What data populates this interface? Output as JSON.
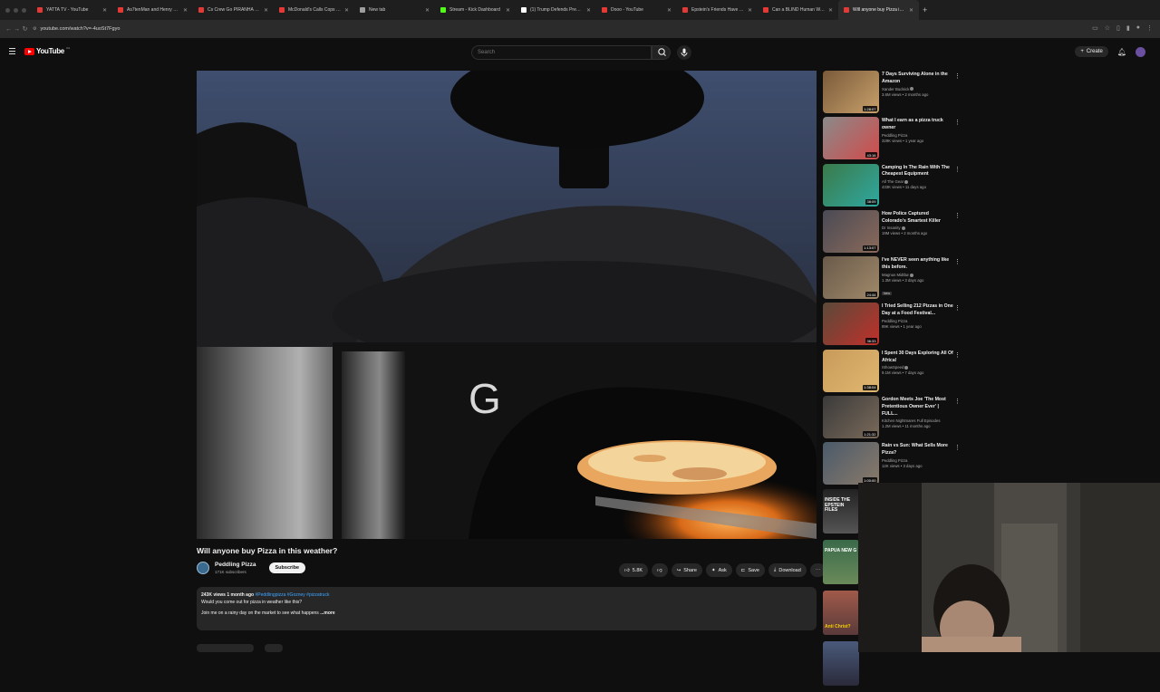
{
  "browser": {
    "tabs": [
      {
        "title": "YATTA TV - YouTube",
        "favicon": "#e53935"
      },
      {
        "title": "As7tenMan and Henry Get In...",
        "favicon": "#e53935"
      },
      {
        "title": "Cs Crew Go PIRANHA FISHI...",
        "favicon": "#e53935"
      },
      {
        "title": "McDonald's Calls Cops on Fi...",
        "favicon": "#e53935"
      },
      {
        "title": "New tab",
        "favicon": "#9e9e9e"
      },
      {
        "title": "Stream - Kick Dashboard",
        "favicon": "#53fc18"
      },
      {
        "title": "(1) Trump Defends Preemptiv...",
        "favicon": "#ffffff"
      },
      {
        "title": "Dooo - YouTube",
        "favicon": "#e53935"
      },
      {
        "title": "Epstein's Friends Have Been...",
        "favicon": "#e53935"
      },
      {
        "title": "Can a BLIND Human Walk Str...",
        "favicon": "#e53935"
      },
      {
        "title": "Will anyone buy Pizza in th...",
        "favicon": "#e53935",
        "active": true
      }
    ],
    "url": "youtube.com/watch?v=-4uoSt7Fgyo"
  },
  "youtube": {
    "logo_text": "YouTube",
    "logo_country": "CA",
    "search_placeholder": "Search",
    "create_label": "Create"
  },
  "video": {
    "title": "Will anyone buy Pizza in this weather?",
    "channel_name": "Peddling Pizza",
    "subscribers": "171K subscribers",
    "subscribe_label": "Subscribe",
    "likes": "5.8K",
    "share_label": "Share",
    "ask_label": "Ask",
    "save_label": "Save",
    "download_label": "Download",
    "oven_brand_letter": "G",
    "description": {
      "meta": "243K views  1 month ago",
      "tags": "#Peddlingpizza #Gozney #pizzatruck",
      "line1": "Would you come out for pizza in weather like this?",
      "line2": "Join me on a rainy day on the market to see what happens",
      "more": "...more"
    }
  },
  "recommendations": [
    {
      "title": "7 Days Surviving Alone in the Amazon",
      "channel": "Xander Budnick",
      "verified": true,
      "views": "3.6M views • 2 months ago",
      "duration": "1:28:07",
      "thumb": [
        "#7a5a3a",
        "#c8a06a"
      ]
    },
    {
      "title": "What I earn as a pizza truck owner",
      "channel": "Peddling Pizza",
      "verified": false,
      "views": "329K views • 1 year ago",
      "duration": "43:16",
      "thumb": [
        "#8a8a8a",
        "#d24a4a"
      ]
    },
    {
      "title": "Camping In The Rain With The Cheapest Equipment",
      "channel": "All The Gear",
      "verified": true,
      "views": "433K views • 11 days ago",
      "duration": "38:09",
      "thumb": [
        "#3b7a4a",
        "#2fa8a0"
      ]
    },
    {
      "title": "How Police Captured Colorado's Smartest Killer",
      "channel": "Dr Insanity",
      "verified": true,
      "views": "19M views • 2 months ago",
      "duration": "1:13:07",
      "thumb": [
        "#4a4a55",
        "#8a6a5a"
      ]
    },
    {
      "title": "I've NEVER seen anything like this before.",
      "channel": "Magnus Midtbø",
      "verified": true,
      "views": "1.3M views • 3 days ago",
      "duration": "24:44",
      "new": "New",
      "thumb": [
        "#6a5a4a",
        "#a0896a"
      ]
    },
    {
      "title": "I Tried Selling 212 Pizzas in One Day at a Food Festival...",
      "channel": "Peddling Pizza",
      "verified": false,
      "views": "89K views • 1 year ago",
      "duration": "36:33",
      "thumb": [
        "#5a4a3a",
        "#c0302a"
      ]
    },
    {
      "title": "I Spent 30 Days Exploring All Of Africa!",
      "channel": "IShowSpeed",
      "verified": true,
      "views": "9.1M views • 7 days ago",
      "duration": "1:38:04",
      "thumb": [
        "#c89a5a",
        "#e0b870"
      ]
    },
    {
      "title": "Gordon Meets Joe 'The Most Pretentious Owner Ever' | FULL...",
      "channel": "Kitchen Nightmares Full Episodes",
      "verified": false,
      "views": "1.2M views • 11 months ago",
      "duration": "1:21:32",
      "thumb": [
        "#3a3a3a",
        "#7a6a5a"
      ]
    },
    {
      "title": "Rain vs Sun: What Sells More Pizza?",
      "channel": "Peddling Pizza",
      "verified": false,
      "views": "12K views • 3 days ago",
      "duration": "1:00:00",
      "thumb": [
        "#4a5a6a",
        "#8a7a6a"
      ]
    }
  ],
  "shorts": [
    {
      "title": "INSIDE THE EPSTEIN FILES"
    },
    {
      "title": "PAPUA NEW G"
    },
    {
      "title": "Anti Christ?"
    },
    {
      "title": ""
    }
  ]
}
